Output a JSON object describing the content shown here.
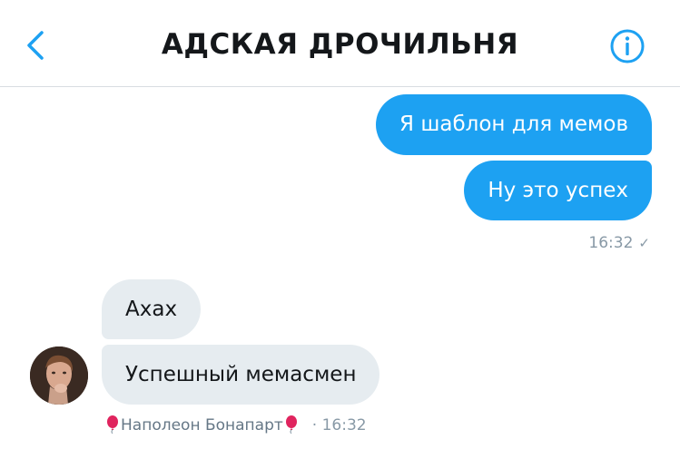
{
  "header": {
    "title": "АДСКАЯ ДРОЧИЛЬНЯ",
    "back_icon": "chevron-left-icon",
    "info_icon": "info-icon",
    "accent_color": "#1da1f2"
  },
  "messages": {
    "outgoing": [
      {
        "text": "Я шаблон для мемов"
      },
      {
        "text": "Ну это успех"
      }
    ],
    "outgoing_time": "16:32",
    "outgoing_status_icon": "checkmark-icon",
    "incoming": [
      {
        "text": "Ахах"
      },
      {
        "text": "Успешный мемасмен"
      }
    ],
    "sender_name": "Наполеон Бонапарт",
    "sender_decoration_icon": "red-balloon-icon",
    "incoming_time": "· 16:32"
  },
  "colors": {
    "outgoing_bubble": "#1da1f2",
    "incoming_bubble": "#e6ecf0",
    "meta_text": "#8899a6"
  }
}
